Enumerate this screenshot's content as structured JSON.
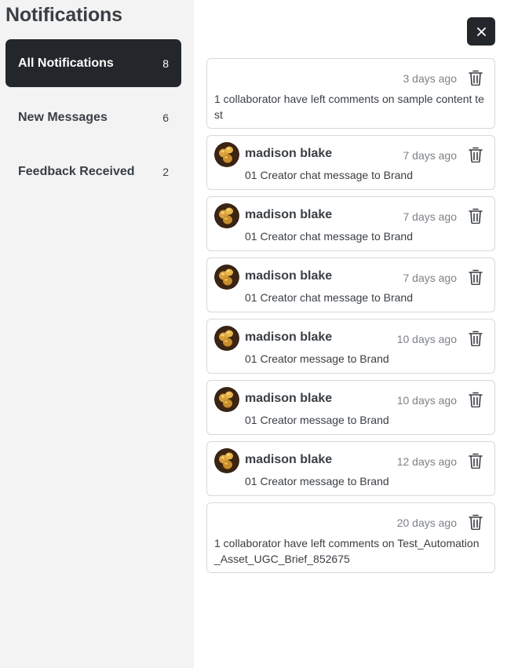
{
  "sidebar": {
    "title": "Notifications",
    "items": [
      {
        "label": "All Notifications",
        "count": "8"
      },
      {
        "label": "New Messages",
        "count": "6"
      },
      {
        "label": "Feedback Received",
        "count": "2"
      }
    ]
  },
  "close_label": "×",
  "notifications": [
    {
      "time": "3 days ago",
      "message": "1 collaborator have left comments on sample content test"
    },
    {
      "name": "madison blake",
      "time": "7 days ago",
      "message": "01 Creator chat message to Brand"
    },
    {
      "name": "madison blake",
      "time": "7 days ago",
      "message": "01 Creator chat message to Brand"
    },
    {
      "name": "madison blake",
      "time": "7 days ago",
      "message": "01 Creator chat message to Brand"
    },
    {
      "name": "madison blake",
      "time": "10 days ago",
      "message": "01 Creator message to Brand"
    },
    {
      "name": "madison blake",
      "time": "10 days ago",
      "message": "01 Creator message to Brand"
    },
    {
      "name": "madison blake",
      "time": "12 days ago",
      "message": "01 Creator message to Brand"
    },
    {
      "time": "20 days ago",
      "message": "1 collaborator have left comments on Test_Automation_Asset_UGC_Brief_852675"
    }
  ],
  "colors": {
    "active_nav": "#23272b",
    "sidebar_bg": "#f3f3f3"
  }
}
